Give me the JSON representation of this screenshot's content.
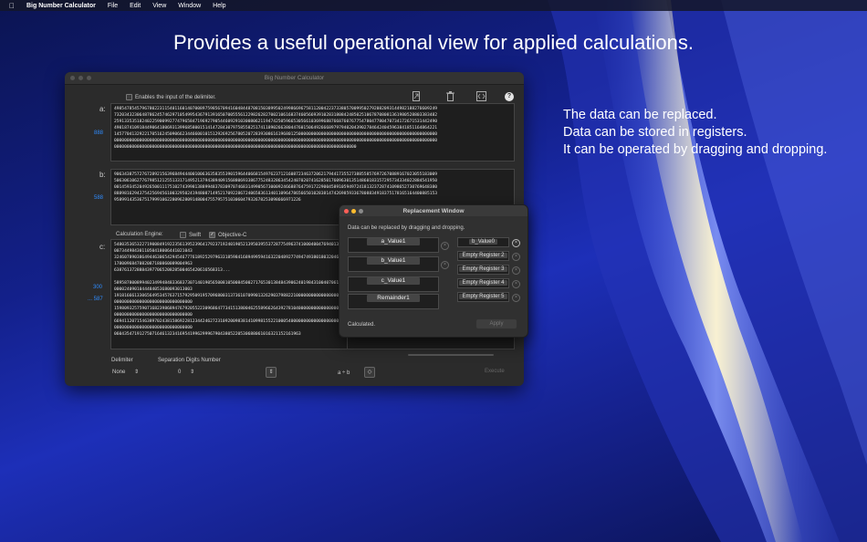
{
  "menubar": {
    "apple_icon": "apple-icon",
    "app_name": "Big Number Calculator",
    "items": [
      "File",
      "Edit",
      "View",
      "Window",
      "Help"
    ]
  },
  "headline": "Provides a useful operational view for applied calculations.",
  "side_text": [
    "The data can be replaced.",
    "Data can be stored in registers.",
    "It can be operated by dragging and dropping."
  ],
  "main_window": {
    "title": "Big Number Calculator",
    "enable_delimiter_label": "Enables the input of the delimiter.",
    "toolbar_icons": [
      "pin-icon",
      "trash-icon",
      "code-icon",
      "help-icon"
    ],
    "help_label": "?",
    "register_a": {
      "label": "a:",
      "count": "888",
      "lines": [
        "49854785457967802231154011601407008975985670941604844870815038995024998669675811200422373380570099502792082093144982188276609249",
        "73203432306487862457462971054995436791391650700555612298262827002106168374605669391028318084248502510678708081361980528803383482",
        "25913353518240225900992774796584719692790544609291030080621194742505966530566103699688766876076775478047780470734172671531442490",
        "49018741091844906418069313996858001514147284307975855825174118902663804476015064926668979794020439027846424045963841851164864221",
        "14577041329221705162450906623446600101512926925678052072839308616196801250000000000000000000000000000000000000000000000000000000",
        "00000000000000000000000000000000000000000000000000000000000000000000000000000000000000000000000000000000000000000000000000000000",
        "000000000000000000000000000000000000000000000000000000000000000000000000000000000000000000000000"
      ]
    },
    "register_b": {
      "label": "b:",
      "count": "588",
      "lines": [
        "90634387572767289215639684944400100636358355390159644066815497623712160872346372062179441735527388558576972670889167023055183009",
        "50630610627767985121255133171495213794389409156880693386775248328634542407020741628501760963013514860183157295734334022884541950",
        "00145934520492650011175102743998138899483783097074683149905673000924668876475917229004589105949724181323728741098652730769648380",
        "88898162943754256945610032950241948087149521709228672406583613401109647865665010283814742698593367808834918375178165164400885153",
        "95899143536751799910622809628091480047557957510306047932678253098666971226"
      ]
    },
    "engine": {
      "label": "Calculation Engine:",
      "options": [
        "Swift",
        "Objective-C"
      ],
      "selected": "Objective-C"
    },
    "register_c": {
      "label": "c:",
      "count_top": "300",
      "count_bottom": "... 587",
      "paragraphs": [
        "54803536532271900849192235613952396417923719240190521395039553728775496374100040047694013050073449843011050418006441021043",
        "32460789038649446306542945467776189252979633185984168949959416322048927749474938018032046071780096847082087180860089004963",
        "6387613728884397706520828500465420616568313...",
        "58958780089940234994848336837307140190565008105008450027176530138484390624019843100407061460000240901044484053680093013003",
        "19181666133065649534576371579295091957096800313736107099013262903798822100000000000000000000000000000000000000000000000000",
        "15980932575907168239868947679205522309686477341513800462558966264392781040000000000000000000000000000000000000000000000000",
        "66941120715463897024381586922812344246272310920098381410998155221000540000000000000000000000000000000000000000000000000000",
        "06043547191275071646132341695419962999679043805220530688061016321152161963"
      ]
    },
    "delimiter": {
      "label": "Delimiter",
      "value": "None"
    },
    "separation": {
      "label": "Separation Digits Number",
      "value": "0"
    },
    "operation": "a ÷ b",
    "execute_label": "Execute"
  },
  "replacement_window": {
    "title": "Replacement Window",
    "description": "Data can be replaced by dragging and dropping.",
    "sources": [
      "a_Value1",
      "b_Value1",
      "c_Value1",
      "Remainder1"
    ],
    "registers": [
      "b_Value0",
      "Empty Register 2",
      "Empty Register 3",
      "Empty Register 4",
      "Empty Register 5"
    ],
    "status": "Calculated.",
    "apply_label": "Apply",
    "traffic_colors": [
      "#ff5f57",
      "#febc2e",
      "#8a8a8a"
    ]
  }
}
